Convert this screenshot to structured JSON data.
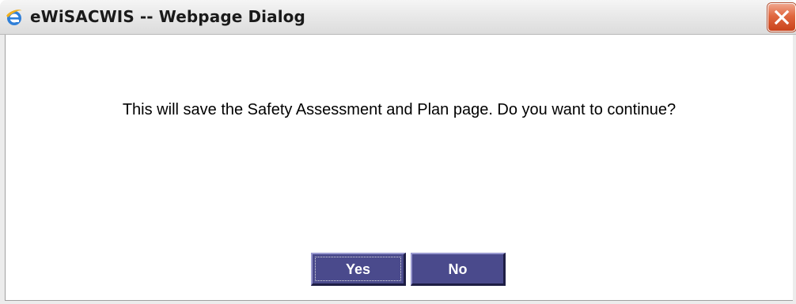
{
  "window": {
    "title": "eWiSACWIS -- Webpage Dialog",
    "icon": "ie-icon",
    "close_icon": "close-icon"
  },
  "dialog": {
    "message": "This will save the Safety Assessment and Plan page. Do you want to continue?",
    "yes_label": "Yes",
    "no_label": "No"
  },
  "colors": {
    "button_bg": "#4a4a8c",
    "button_text": "#ffffff",
    "close_red": "#e0673f"
  }
}
